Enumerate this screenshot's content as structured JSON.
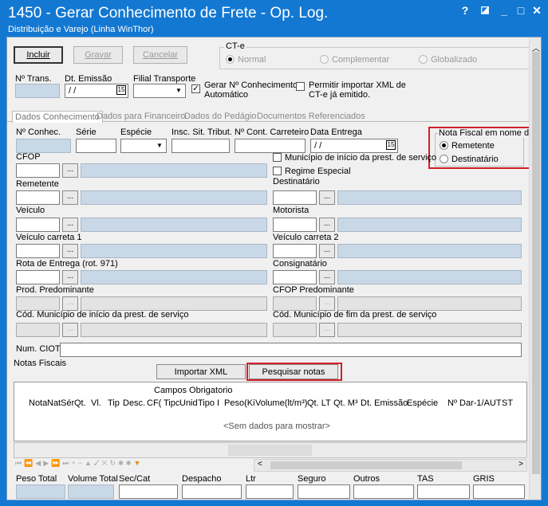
{
  "window": {
    "title": "1450 - Gerar Conhecimento de Frete - Op. Log.",
    "subtitle": "Distribuição e Varejo (Linha WinThor)",
    "help": "?",
    "minimize": "_",
    "maximize": "□",
    "close": "✕"
  },
  "toolbar": {
    "incluir": "Incluir",
    "gravar": "Gravar",
    "cancelar": "Cancelar"
  },
  "cte": {
    "label": "CT-e",
    "normal": "Normal",
    "complementar": "Complementar",
    "globalizado": "Globalizado"
  },
  "top_fields": {
    "ntrans_label": "Nº Trans.",
    "dtemissao_label": "Dt. Emissão",
    "dtemissao_value": "/ /",
    "filial_label": "Filial Transporte",
    "gerar_label_1": "Gerar Nº Conhecimento",
    "gerar_label_2": "Automático",
    "permitir_label_1": "Permitir importar XML de",
    "permitir_label_2": "CT-e já emitido.",
    "check_mark": "✓"
  },
  "tabs": [
    "Dados Conhecimento",
    "Dados para Financeiro",
    "Dados do Pedágio",
    "Documentos Referenciados"
  ],
  "form": {
    "nconhec": "Nº Conhec.",
    "serie": "Série",
    "especie": "Espécie",
    "insc": "Insc. Sit. Tribut.",
    "ncont": "Nº Cont. Carreteiro",
    "dataentrega": "Data Entrega",
    "dataentrega_value": "/ /",
    "cfop": "CFOP",
    "municipio_inicio": "Município de início da prest. de serviço",
    "regime": "Regime Especial",
    "remetente": "Remetente",
    "destinatario": "Destinatário",
    "veiculo": "Veículo",
    "motorista": "Motorista",
    "veiculo_carreta1": "Veículo carreta 1",
    "veiculo_carreta2": "Veículo carreta 2",
    "rota": "Rota de Entrega (rot. 971)",
    "consignatario": "Consignatário",
    "prod": "Prod. Predominante",
    "cfop_pred": "CFOP Predominante",
    "cod_mun_inicio": "Cód. Município de início da prest. de serviço",
    "cod_mun_fim": "Cód. Município de fim da prest. de serviço",
    "num_ciot": "Num. CIOT:",
    "dots": "..."
  },
  "nota_fiscal": {
    "label": "Nota Fiscal em nome do:",
    "remetente": "Remetente",
    "destinatario": "Destinatário"
  },
  "notas": {
    "label": "Notas Fiscais",
    "importar": "Importar XML",
    "pesquisar": "Pesquisar notas",
    "group_header": "Campos Obrigatorio",
    "columns": [
      "Nota",
      "Nat",
      "Sér",
      "Qt.",
      "Vl.",
      "Tip",
      "Desc.",
      "CF(",
      "Tipc",
      "Unid",
      "Tipo I",
      "Peso(Ki",
      "Volume(lt/m³)",
      "Qt. LT",
      "Qt. M³",
      "Dt. Emissão",
      "Espécie",
      "Nº Dar-1/AUT",
      "ST"
    ],
    "empty": "<Sem dados para mostrar>"
  },
  "totals": [
    "Peso Total",
    "Volume Total",
    "Sec/Cat",
    "Despacho",
    "Ltr",
    "Seguro",
    "Outros",
    "TAS",
    "GRIS"
  ],
  "colors": {
    "titlebar": "#1378d2",
    "highlight": "#d0202a",
    "readonly": "#c9d8e6"
  }
}
